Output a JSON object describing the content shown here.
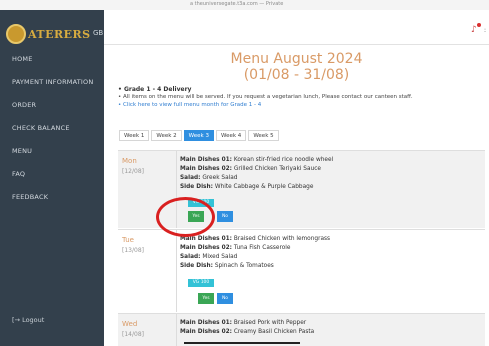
{
  "browser": {
    "url": "a theuniversegate.t3a.com — Private"
  },
  "sidebar": {
    "logo_text": "ATERERS",
    "lang_label": "GB",
    "items": [
      {
        "label": "HOME"
      },
      {
        "label": "PAYMENT INFORMATION"
      },
      {
        "label": "ORDER"
      },
      {
        "label": "CHECK BALANCE"
      },
      {
        "label": "MENU"
      },
      {
        "label": "FAQ"
      },
      {
        "label": "FEEDBACK"
      }
    ],
    "logout_label": "Logout"
  },
  "header": {
    "bell_icon": "bell-icon",
    "accent": "#d93030"
  },
  "menu": {
    "title": "Menu August 2024",
    "range": "(01/08 - 31/08)",
    "grade": "Grade 1 - 4 Delivery",
    "note1": "All items on the menu will be served. If you request a vegetarian lunch, Please contact our canteen staff.",
    "note2": "Click here to view full menu month for Grade 1 - 4",
    "weeks": [
      "Week 1",
      "Week 2",
      "Week 3",
      "Week 4",
      "Week 5"
    ],
    "active_week": "Week 3"
  },
  "days": [
    {
      "name": "Mon",
      "date": "[12/08]",
      "dishes": [
        {
          "label": "Main Dishes 01:",
          "value": "Korean stir-fried rice noodle wheel"
        },
        {
          "label": "Main Dishes 02:",
          "value": "Grilled Chicken Teriyaki Sauce"
        },
        {
          "label": "Salad:",
          "value": "Greek Salad"
        },
        {
          "label": "Side Dish:",
          "value": "White Cabbage & Purple Cabbage"
        }
      ],
      "veg": "VG  100",
      "yes": "Yes",
      "no": "No"
    },
    {
      "name": "Tue",
      "date": "[13/08]",
      "dishes": [
        {
          "label": "Main Dishes 01:",
          "value": "Braised Chicken with lemongrass"
        },
        {
          "label": "Main Dishes 02:",
          "value": "Tuna Fish Casserole"
        },
        {
          "label": "Salad:",
          "value": "Mixed Salad"
        },
        {
          "label": "Side Dish:",
          "value": "Spinach & Tomatoes"
        }
      ],
      "veg": "VG  100",
      "yes": "Yes",
      "no": "No"
    },
    {
      "name": "Wed",
      "date": "[14/08]",
      "dishes": [
        {
          "label": "Main Dishes 01:",
          "value": "Braised Pork with Pepper"
        },
        {
          "label": "Main Dishes 02:",
          "value": "Creamy Basil Chicken Pasta"
        }
      ]
    }
  ],
  "colors": {
    "sidebar": "#33404c",
    "title": "#d99a66",
    "primary": "#2f8fe0",
    "success": "#3aa655",
    "info": "#33c2d6",
    "annotation": "#d92020"
  }
}
